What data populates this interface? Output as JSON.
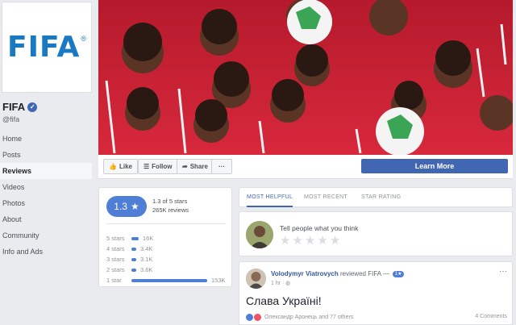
{
  "page": {
    "logo_text": "FIFA",
    "logo_reg": "®",
    "name": "FIFA",
    "handle": "@fifa"
  },
  "nav": {
    "items": [
      {
        "label": "Home"
      },
      {
        "label": "Posts"
      },
      {
        "label": "Reviews"
      },
      {
        "label": "Videos"
      },
      {
        "label": "Photos"
      },
      {
        "label": "About"
      },
      {
        "label": "Community"
      },
      {
        "label": "Info and Ads"
      }
    ],
    "active": "Reviews"
  },
  "actions": {
    "like": "Like",
    "follow": "Follow",
    "share": "Share",
    "more": "···",
    "learn_more": "Learn More"
  },
  "rating": {
    "score": "1.3",
    "score_icon": "star-icon",
    "summary_line1": "1.3 of 5 stars",
    "summary_line2": "265K reviews",
    "rows": [
      {
        "label": "5 stars",
        "count": "16K",
        "fraction": 0.1
      },
      {
        "label": "4 stars",
        "count": "3.4K",
        "fraction": 0.02
      },
      {
        "label": "3 stars",
        "count": "3.1K",
        "fraction": 0.02
      },
      {
        "label": "2 stars",
        "count": "3.6K",
        "fraction": 0.02
      },
      {
        "label": "1 star",
        "count": "153K",
        "fraction": 1.0
      }
    ],
    "accent": "#4f7ed6"
  },
  "tabs": [
    {
      "label": "MOST HELPFUL"
    },
    {
      "label": "MOST RECENT"
    },
    {
      "label": "STAR RATING"
    }
  ],
  "prompt": {
    "text": "Tell people what you think"
  },
  "review": {
    "author": "Volodymyr Viatrovych",
    "action": "reviewed FIFA —",
    "rating_badge": "1★",
    "time": "1 hr",
    "body": "Слава Україні!",
    "reactions": "Олександр Аронець and 77 others",
    "comments": "4 Comments"
  },
  "colors": {
    "brand_blue": "#4267b2",
    "fifa_blue": "#1a79c3"
  }
}
